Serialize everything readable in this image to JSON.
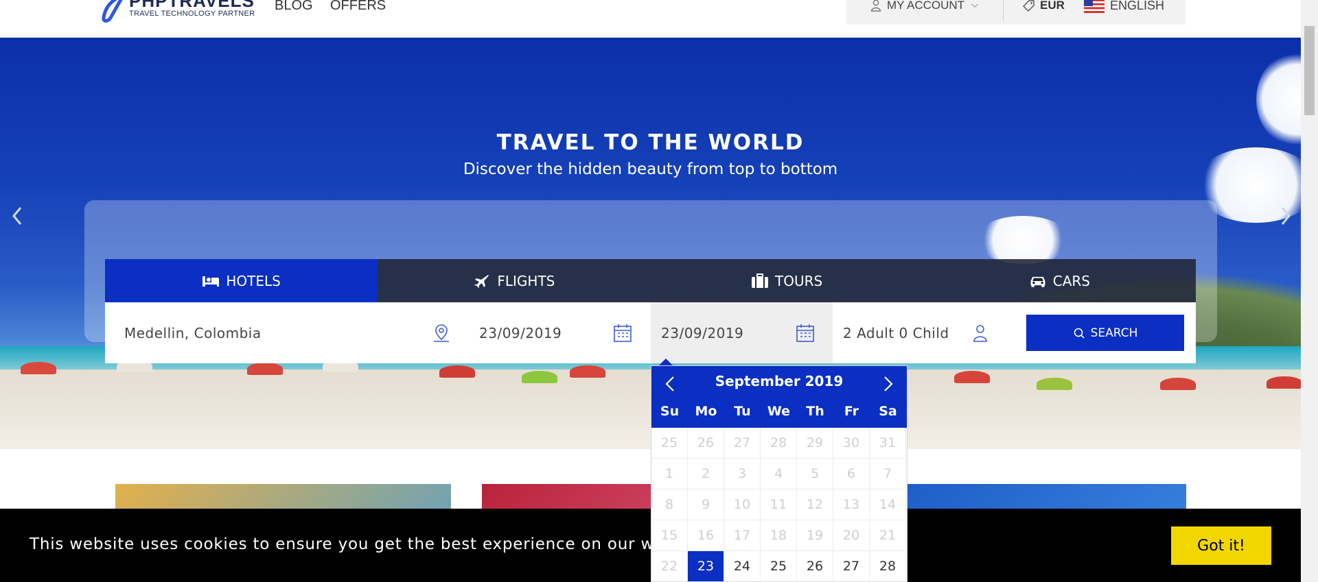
{
  "header": {
    "brand": "PHPTRAVELS",
    "tagline": "TRAVEL TECHNOLOGY PARTNER",
    "nav": [
      {
        "label": "BLOG"
      },
      {
        "label": "OFFERS"
      }
    ],
    "account_label": "MY ACCOUNT",
    "currency": "EUR",
    "language": "ENGLISH"
  },
  "hero": {
    "title": "TRAVEL TO THE WORLD",
    "subtitle": "Discover the hidden beauty from top to bottom"
  },
  "tabs": [
    {
      "label": "HOTELS",
      "icon": "bed-icon",
      "active": true
    },
    {
      "label": "FLIGHTS",
      "icon": "plane-icon",
      "active": false
    },
    {
      "label": "TOURS",
      "icon": "suitcase-icon",
      "active": false
    },
    {
      "label": "CARS",
      "icon": "car-icon",
      "active": false
    }
  ],
  "search": {
    "destination": "Medellin, Colombia",
    "checkin": "23/09/2019",
    "checkout": "23/09/2019",
    "guests": "2 Adult 0 Child",
    "button_label": "SEARCH"
  },
  "calendar": {
    "month": "September 2019",
    "weekdays": [
      "Su",
      "Mo",
      "Tu",
      "We",
      "Th",
      "Fr",
      "Sa"
    ],
    "weeks": [
      [
        "25",
        "26",
        "27",
        "28",
        "29",
        "30",
        "31"
      ],
      [
        "1",
        "2",
        "3",
        "4",
        "5",
        "6",
        "7"
      ],
      [
        "8",
        "9",
        "10",
        "11",
        "12",
        "13",
        "14"
      ],
      [
        "15",
        "16",
        "17",
        "18",
        "19",
        "20",
        "21"
      ],
      [
        "22",
        "23",
        "24",
        "25",
        "26",
        "27",
        "28"
      ]
    ],
    "selected": "23"
  },
  "cookie": {
    "message": "This website uses cookies to ensure you get the best experience on our websi",
    "button_label": "Got it!"
  },
  "colors": {
    "accent": "#0a2fc2",
    "cookie_button": "#f1d600"
  }
}
